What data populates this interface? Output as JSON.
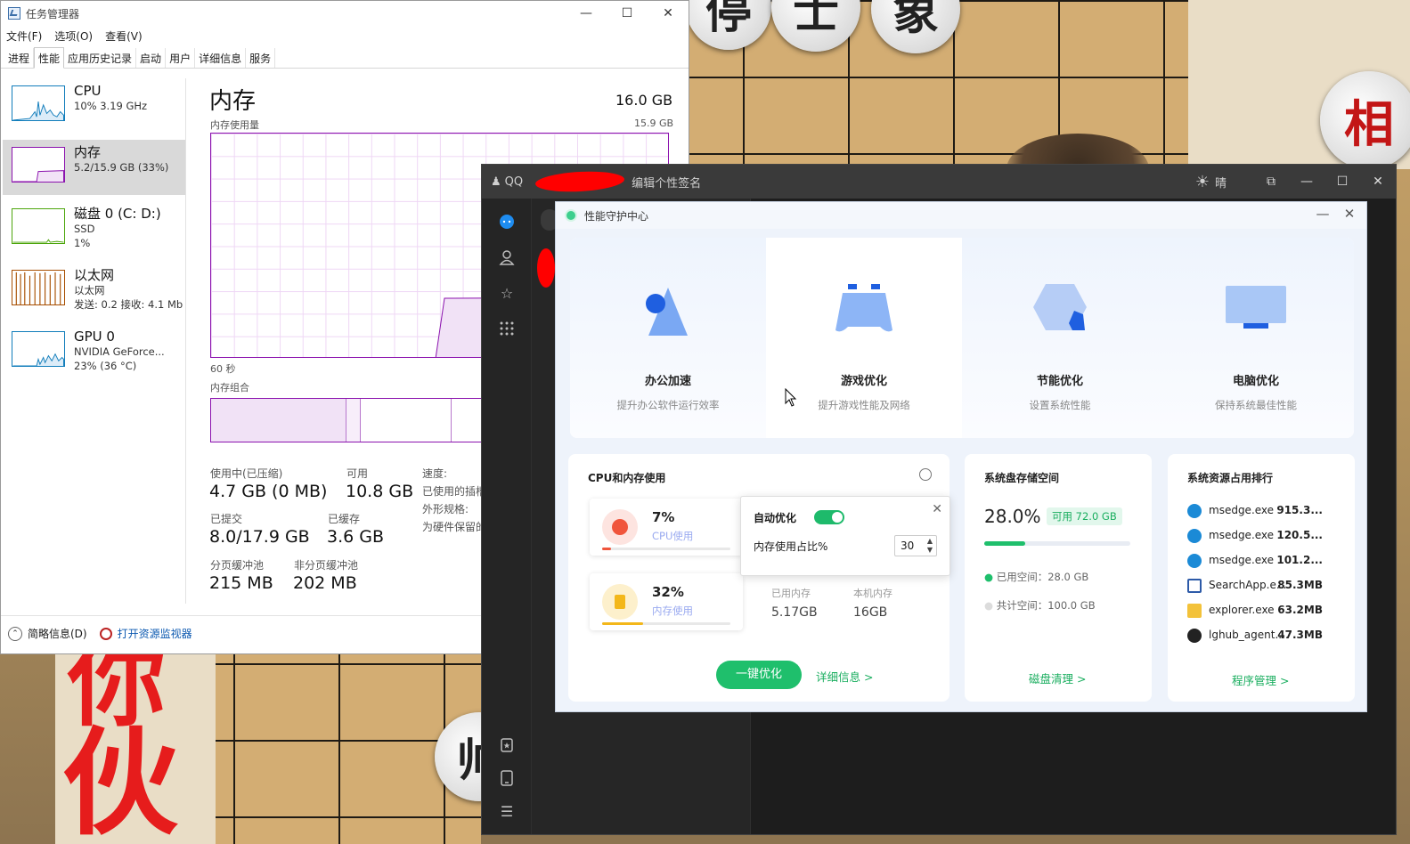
{
  "taskmgr": {
    "title": "任务管理器",
    "menu": [
      "文件(F)",
      "选项(O)",
      "查看(V)"
    ],
    "tabs": [
      "进程",
      "性能",
      "应用历史记录",
      "启动",
      "用户",
      "详细信息",
      "服务"
    ],
    "side": [
      {
        "name": "CPU",
        "sub1": "10% 3.19 GHz",
        "sub2": "",
        "sub3": "",
        "color": "#117dbb"
      },
      {
        "name": "内存",
        "sub1": "5.2/15.9 GB (33%)",
        "sub2": "",
        "sub3": "",
        "color": "#8b12ae"
      },
      {
        "name": "磁盘 0 (C: D:)",
        "sub1": "SSD",
        "sub2": "1%",
        "sub3": "",
        "color": "#4da60c"
      },
      {
        "name": "以太网",
        "sub1": "以太网",
        "sub2": "发送: 0.2  接收: 4.1 Mb",
        "sub3": "",
        "color": "#a74f01"
      },
      {
        "name": "GPU 0",
        "sub1": "NVIDIA GeForce...",
        "sub2": "23% (36 °C)",
        "sub3": "",
        "color": "#117dbb"
      }
    ],
    "memory": {
      "heading": "内存",
      "total": "16.0 GB",
      "usage_label": "内存使用量",
      "max_label": "15.9 GB",
      "time_label": "60 秒",
      "composition_label": "内存组合",
      "in_use_label": "使用中(已压缩)",
      "in_use_value": "4.7 GB (0 MB)",
      "available_label": "可用",
      "available_value": "10.8 GB",
      "speed_label": "速度:",
      "slots_label": "已使用的插槽",
      "form_label": "外形规格:",
      "reserved_label": "为硬件保留的",
      "committed_label": "已提交",
      "committed_value": "8.0/17.9 GB",
      "cached_label": "已缓存",
      "cached_value": "3.6 GB",
      "paged_label": "分页缓冲池",
      "paged_value": "215 MB",
      "nonpaged_label": "非分页缓冲池",
      "nonpaged_value": "202 MB"
    },
    "footer": {
      "brief": "简略信息(D)",
      "monitor": "打开资源监视器"
    }
  },
  "qq": {
    "brand": "QQ",
    "signature": "编辑个性签名",
    "weather": "晴"
  },
  "perf": {
    "title": "性能守护中心",
    "cards": [
      {
        "title": "办公加速",
        "sub": "提升办公软件运行效率"
      },
      {
        "title": "游戏优化",
        "sub": "提升游戏性能及网络"
      },
      {
        "title": "节能优化",
        "sub": "设置系统性能"
      },
      {
        "title": "电脑优化",
        "sub": "保持系统最佳性能"
      }
    ],
    "cpu_mem": {
      "title": "CPU和内存使用",
      "cpu_pct": "7%",
      "cpu_label": "CPU使用",
      "cpu_fraction": 0.07,
      "mem_pct": "32%",
      "mem_label": "内存使用",
      "mem_fraction": 0.32,
      "used_label": "已用内存",
      "used_value": "5.17GB",
      "local_label": "本机内存",
      "local_value": "16GB",
      "popup_auto": "自动优化",
      "popup_threshold": "内存使用占比%",
      "popup_value": "30",
      "optimize_button": "一键优化",
      "detail_link": "详细信息 >"
    },
    "disk": {
      "title": "系统盘存储空间",
      "pct": "28.0%",
      "free_badge": "可用 72.0 GB",
      "fraction": 0.28,
      "used": "已用空间：28.0 GB",
      "total": "共计空间：100.0 GB",
      "clean_link": "磁盘清理 >"
    },
    "ranking": {
      "title": "系统资源占用排行",
      "rows": [
        {
          "name": "msedge.exe",
          "value": "915.3..."
        },
        {
          "name": "msedge.exe",
          "value": "120.5..."
        },
        {
          "name": "msedge.exe",
          "value": "101.2..."
        },
        {
          "name": "SearchApp.e...",
          "value": "85.3MB"
        },
        {
          "name": "explorer.exe",
          "value": "63.2MB"
        },
        {
          "name": "lghub_agent....",
          "value": "47.3MB"
        }
      ],
      "manage_link": "程序管理 >"
    }
  },
  "wallpaper": {
    "pieces_top": [
      "停",
      "士",
      "象"
    ],
    "piece_right": "相",
    "red_chars": [
      "你",
      "伙"
    ],
    "piece_bottom": "帅"
  }
}
